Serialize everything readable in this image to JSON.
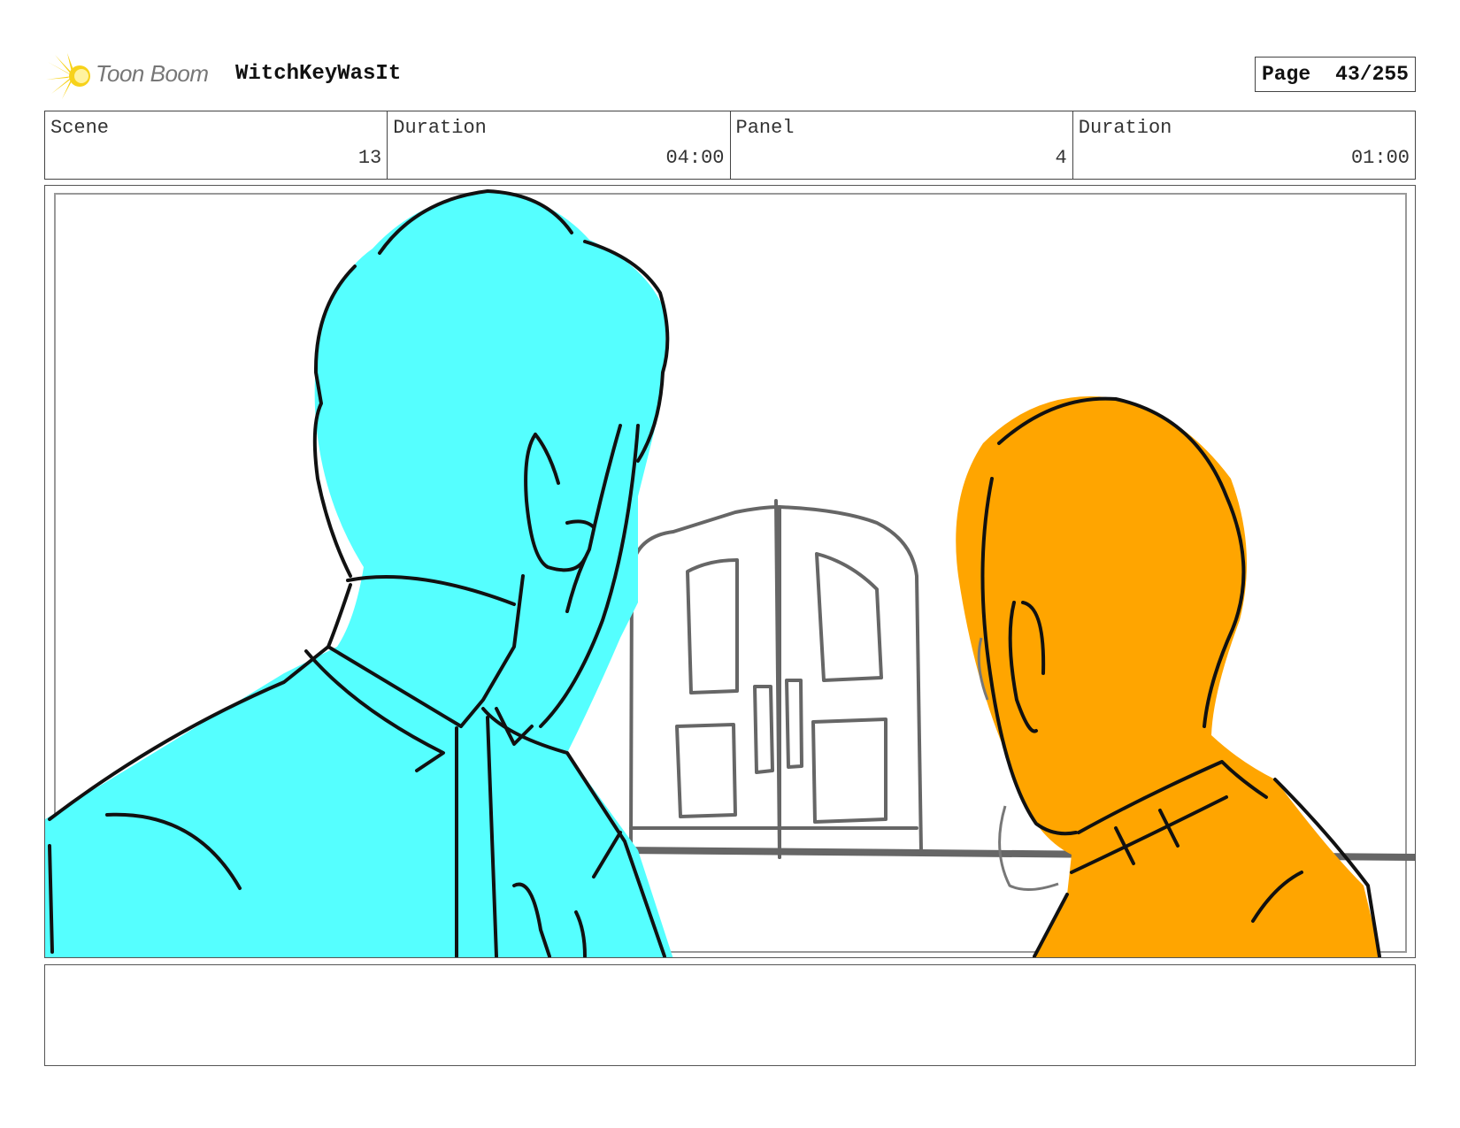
{
  "header": {
    "logo_text": "Toon Boom",
    "project_title": "WitchKeyWasIt",
    "page_label": "Page",
    "page_value": "43/255"
  },
  "info": {
    "scene_label": "Scene",
    "scene_value": "13",
    "scene_duration_label": "Duration",
    "scene_duration_value": "04:00",
    "panel_label": "Panel",
    "panel_value": "4",
    "panel_duration_label": "Duration",
    "panel_duration_value": "01:00"
  },
  "colors": {
    "left_character_fill": "#55ffff",
    "right_character_fill": "#ffa500",
    "logo_yellow": "#f7d21a",
    "sketch_line": "#111111",
    "background_line": "#666666"
  },
  "notes": {
    "text": ""
  }
}
